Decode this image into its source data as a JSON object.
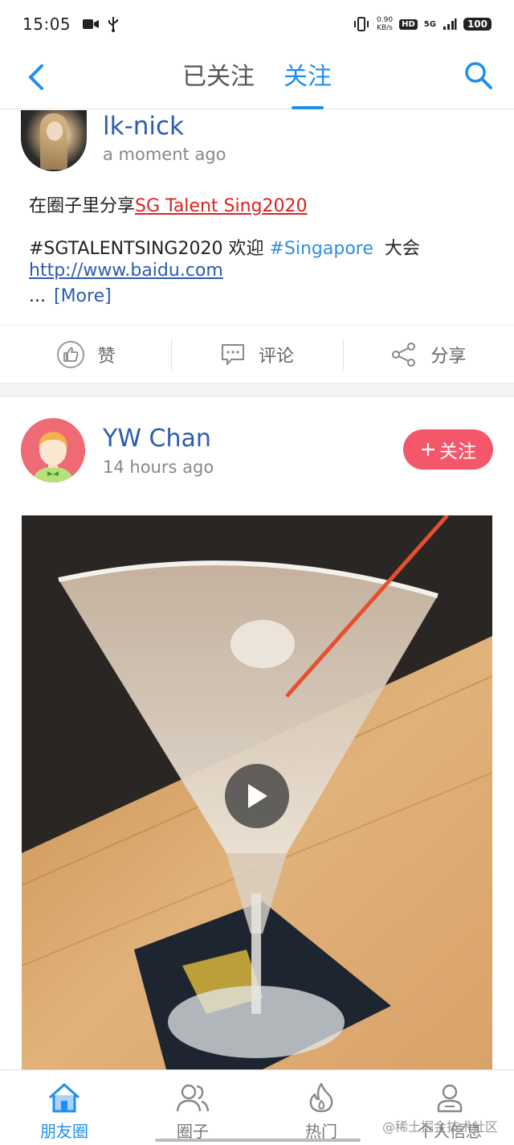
{
  "status_bar": {
    "time": "15:05",
    "net_speed_value": "0.90",
    "net_speed_unit": "KB/s",
    "hd_label": "HD",
    "network_label": "5G",
    "battery": "100"
  },
  "header": {
    "tabs": [
      {
        "label": "已关注",
        "active": false
      },
      {
        "label": "关注",
        "active": true
      }
    ]
  },
  "post1": {
    "username": "lk-nick",
    "time": "a moment ago",
    "share_prefix": "在圈子里分享",
    "share_link": "SG Talent Sing2020",
    "line2_tag1": "#SGTALENTSING2020",
    "line2_text1": "欢迎",
    "line2_tag2": "#Singapore",
    "line2_text2": "大会",
    "url": "http://www.baidu.com",
    "ellipsis": "...",
    "more": "[More]"
  },
  "actions": {
    "like": "赞",
    "comment": "评论",
    "share": "分享"
  },
  "post2": {
    "username": "YW Chan",
    "time": "14 hours ago",
    "follow_label": "关注",
    "media_type": "video"
  },
  "bottom_nav": {
    "items": [
      {
        "label": "朋友圈",
        "icon": "home-icon",
        "active": true
      },
      {
        "label": "圈子",
        "icon": "group-icon",
        "active": false
      },
      {
        "label": "热门",
        "icon": "fire-icon",
        "active": false
      },
      {
        "label": "个人信息",
        "icon": "person-icon",
        "active": false
      }
    ]
  },
  "watermark": "@稀土掘金技术社区",
  "colors": {
    "accent": "#1e8ff0",
    "username": "#2a5db0",
    "link_red": "#e02020",
    "follow_button": "#f4576a"
  }
}
